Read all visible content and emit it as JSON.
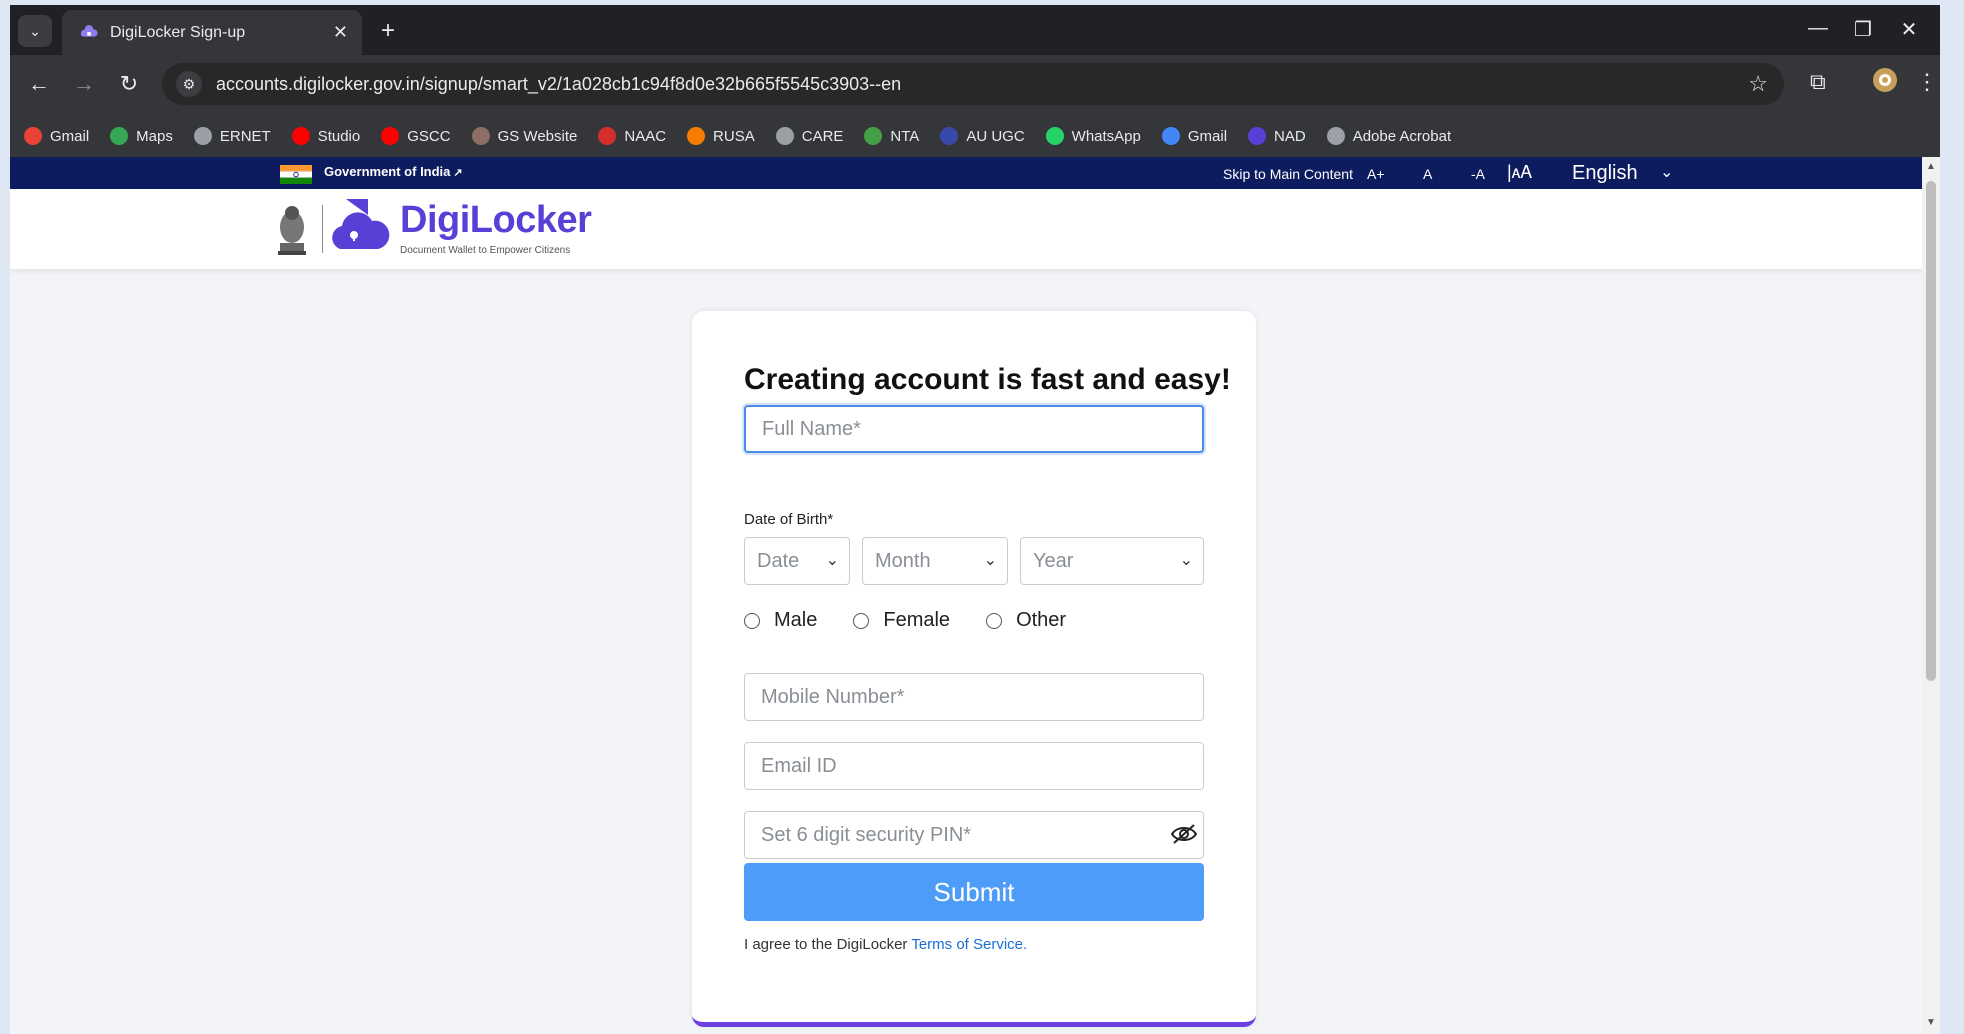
{
  "browser": {
    "tab_title": "DigiLocker Sign-up",
    "url": "accounts.digilocker.gov.in/signup/smart_v2/1a028cb1c94f8d0e32b665f5545c3903--en",
    "bookmarks": [
      {
        "label": "Gmail",
        "icon": "gmail-icon",
        "color": "#ea4335"
      },
      {
        "label": "Maps",
        "icon": "maps-icon",
        "color": "#34a853"
      },
      {
        "label": "ERNET",
        "icon": "globe-icon",
        "color": "#9aa0a6"
      },
      {
        "label": "Studio",
        "icon": "youtube-icon",
        "color": "#ff0000"
      },
      {
        "label": "GSCC",
        "icon": "youtube-icon",
        "color": "#ff0000"
      },
      {
        "label": "GS Website",
        "icon": "gs-icon",
        "color": "#8d6e63"
      },
      {
        "label": "NAAC",
        "icon": "naac-icon",
        "color": "#d32f2f"
      },
      {
        "label": "RUSA",
        "icon": "rusa-icon",
        "color": "#f57c00"
      },
      {
        "label": "CARE",
        "icon": "globe-icon",
        "color": "#9aa0a6"
      },
      {
        "label": "NTA",
        "icon": "nta-icon",
        "color": "#43a047"
      },
      {
        "label": "AU UGC",
        "icon": "ugc-icon",
        "color": "#3949ab"
      },
      {
        "label": "WhatsApp",
        "icon": "whatsapp-icon",
        "color": "#25d366"
      },
      {
        "label": "Gmail",
        "icon": "google-icon",
        "color": "#4285f4"
      },
      {
        "label": "NAD",
        "icon": "digilocker-icon",
        "color": "#5a3fd6"
      },
      {
        "label": "Adobe Acrobat",
        "icon": "globe-icon",
        "color": "#9aa0a6"
      }
    ]
  },
  "gov_bar": {
    "label": "Government of India",
    "skip_link": "Skip to Main Content",
    "font_increase": "A+",
    "font_normal": "A",
    "font_decrease": "-A",
    "language": "English"
  },
  "header": {
    "brand": "DigiLocker",
    "tagline": "Document Wallet to Empower Citizens"
  },
  "form": {
    "title": "Creating account is fast and easy!",
    "full_name_placeholder": "Full Name*",
    "dob_label": "Date of Birth*",
    "date_select": "Date",
    "month_select": "Month",
    "year_select": "Year",
    "gender_options": [
      "Male",
      "Female",
      "Other"
    ],
    "mobile_placeholder": "Mobile Number*",
    "email_placeholder": "Email ID",
    "pin_placeholder": "Set 6 digit security PIN*",
    "submit_label": "Submit",
    "terms_prefix": "I agree to the DigiLocker ",
    "terms_link": "Terms of Service."
  },
  "colors": {
    "brand": "#5a3fd6",
    "submit": "#4d9cf8",
    "gov_bar": "#0d1c5f"
  }
}
